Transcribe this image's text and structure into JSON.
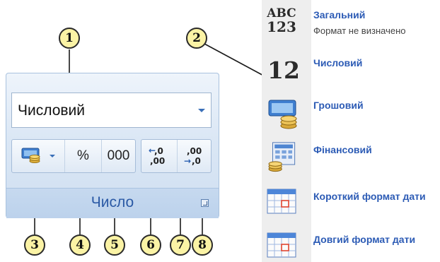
{
  "ribbon": {
    "format_value": "Числовий",
    "percent_label": "%",
    "thousands_label": "000",
    "group_label": "Число"
  },
  "callouts": [
    "1",
    "2",
    "3",
    "4",
    "5",
    "6",
    "7",
    "8"
  ],
  "format_list": [
    {
      "title": "Загальний",
      "subtitle": "Формат не визначено",
      "icon": "abc-123-icon",
      "icon_text_top": "ABC",
      "icon_text_bottom": "123"
    },
    {
      "title": "Числовий",
      "icon": "number-12-icon",
      "icon_text": "12"
    },
    {
      "title": "Грошовий",
      "icon": "currency-icon"
    },
    {
      "title": "Фінансовий",
      "icon": "accounting-icon"
    },
    {
      "title": "Короткий формат дати",
      "icon": "calendar-icon"
    },
    {
      "title": "Довгий формат дати",
      "icon": "calendar-icon"
    }
  ],
  "colors": {
    "callout_fill": "#fbf3a5",
    "link_blue": "#2c5bb5",
    "ribbon_label": "#2a59a5"
  }
}
